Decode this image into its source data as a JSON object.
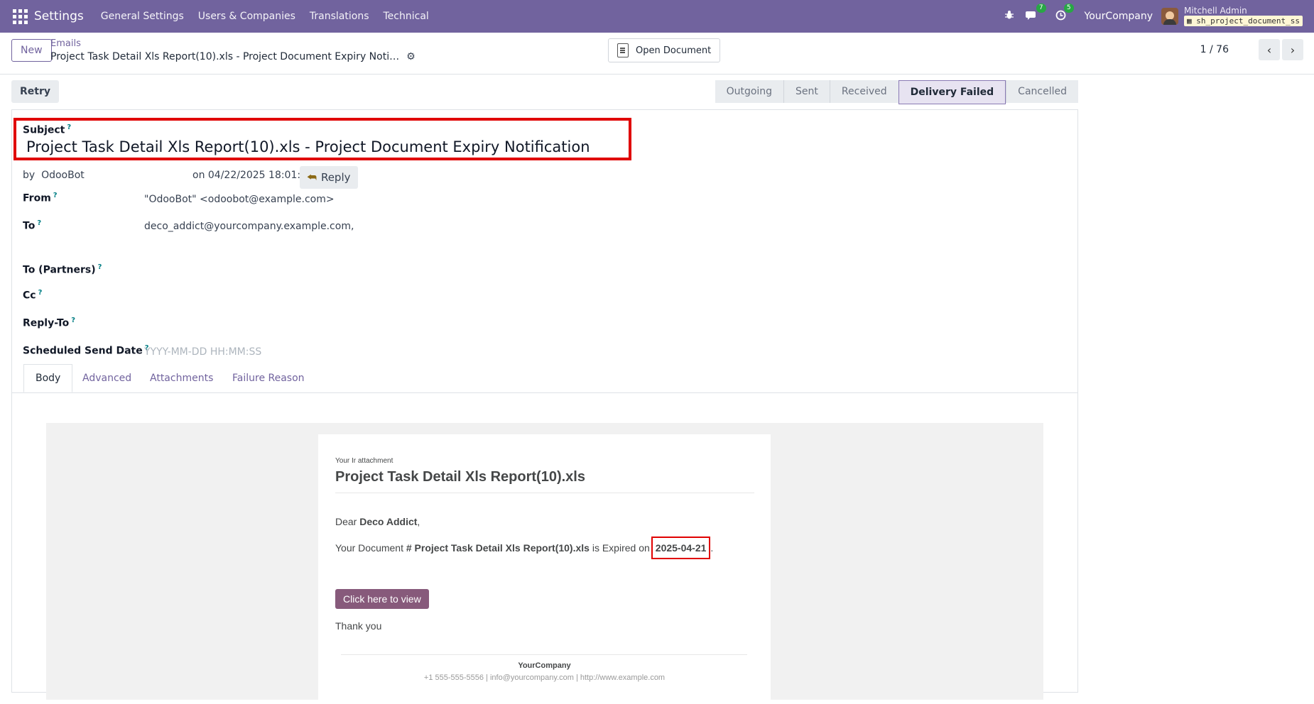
{
  "navbar": {
    "app_name": "Settings",
    "menu": [
      "General Settings",
      "Users & Companies",
      "Translations",
      "Technical"
    ],
    "chat_count": "7",
    "activity_count": "5",
    "company": "YourCompany",
    "user_name": "Mitchell Admin",
    "database": "sh_project_document_ss"
  },
  "control": {
    "new_label": "New",
    "breadcrumb_parent": "Emails",
    "breadcrumb_current": "Project Task Detail Xls Report(10).xls - Project Document Expiry Noti…",
    "open_document_label": "Open Document",
    "pager": "1 / 76"
  },
  "statusbar": {
    "retry_label": "Retry",
    "stages": [
      "Outgoing",
      "Sent",
      "Received",
      "Delivery Failed",
      "Cancelled"
    ],
    "active_stage": "Delivery Failed"
  },
  "form": {
    "subject_label": "Subject",
    "subject": "Project Task Detail Xls Report(10).xls - Project Document Expiry Notification",
    "by_prefix": "by",
    "author": "OdooBot",
    "date_text": "on 04/22/2025 18:01:55",
    "reply_label": "Reply",
    "fields": {
      "from_label": "From",
      "from_value": "\"OdooBot\" <odoobot@example.com>",
      "to_label": "To",
      "to_value": "deco_addict@yourcompany.example.com,",
      "to_partners_label": "To (Partners)",
      "cc_label": "Cc",
      "reply_to_label": "Reply-To",
      "scheduled_label": "Scheduled Send Date",
      "scheduled_placeholder": "YYYY-MM-DD HH:MM:SS"
    }
  },
  "tabs": [
    "Body",
    "Advanced",
    "Attachments",
    "Failure Reason"
  ],
  "email": {
    "small_header": "Your Ir attachment",
    "title": "Project Task Detail Xls Report(10).xls",
    "dear": "Dear",
    "recipient": "Deco Addict",
    "doc_prefix": "Your Document",
    "doc_name": "# Project Task Detail Xls Report(10).xls",
    "expired_text": "is Expired on",
    "expiry_date": "2025-04-21",
    "button_label": "Click here to view",
    "thanks": "Thank you",
    "footer_company": "YourCompany",
    "footer_contact": "+1 555-555-5556 | info@yourcompany.com | http://www.example.com"
  }
}
